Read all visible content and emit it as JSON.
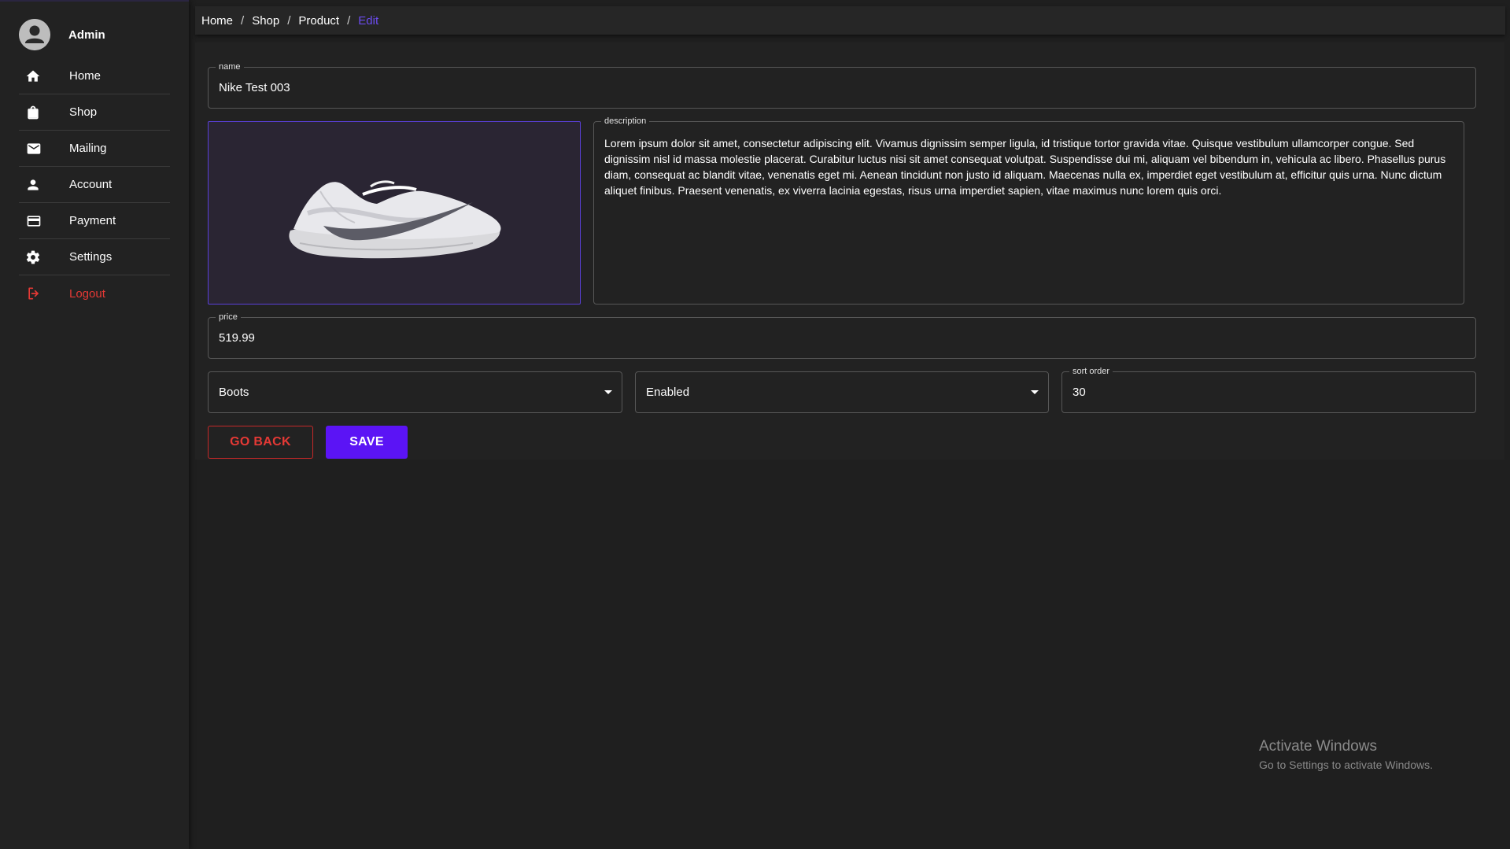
{
  "sidebar": {
    "profile_name": "Admin",
    "items": [
      {
        "label": "Home",
        "icon": "home-icon"
      },
      {
        "label": "Shop",
        "icon": "shopping-bag-icon"
      },
      {
        "label": "Mailing",
        "icon": "mail-icon"
      },
      {
        "label": "Account",
        "icon": "person-icon"
      },
      {
        "label": "Payment",
        "icon": "credit-card-icon"
      },
      {
        "label": "Settings",
        "icon": "gear-icon"
      },
      {
        "label": "Logout",
        "icon": "logout-icon"
      }
    ]
  },
  "breadcrumb": {
    "items": [
      "Home",
      "Shop",
      "Product"
    ],
    "current": "Edit",
    "separator": "/"
  },
  "form": {
    "name": {
      "label": "name",
      "value": "Nike Test 003"
    },
    "description": {
      "label": "description",
      "value": "Lorem ipsum dolor sit amet, consectetur adipiscing elit. Vivamus dignissim semper ligula, id tristique tortor gravida vitae. Quisque vestibulum ullamcorper congue. Sed dignissim nisl id massa molestie placerat. Curabitur luctus nisi sit amet consequat volutpat. Suspendisse dui mi, aliquam vel bibendum in, vehicula ac libero. Phasellus purus diam, consequat ac blandit vitae, venenatis eget mi. Aenean tincidunt non justo id aliquam. Maecenas nulla ex, imperdiet eget vestibulum at, efficitur quis urna. Nunc dictum aliquet finibus. Praesent venenatis, ex viverra lacinia egestas, risus urna imperdiet sapien, vitae maximus nunc lorem quis orci."
    },
    "price": {
      "label": "price",
      "value": "519.99"
    },
    "category": {
      "value": "Boots"
    },
    "status": {
      "value": "Enabled"
    },
    "sort_order": {
      "label": "sort order",
      "value": "30"
    },
    "image_icon": "sneaker-image"
  },
  "buttons": {
    "go_back": "GO BACK",
    "save": "SAVE"
  },
  "watermark": {
    "title": "Activate Windows",
    "subtitle": "Go to Settings to activate Windows."
  },
  "colors": {
    "accent": "#5b14f5",
    "danger": "#e53935",
    "background": "#1f1f1f"
  }
}
